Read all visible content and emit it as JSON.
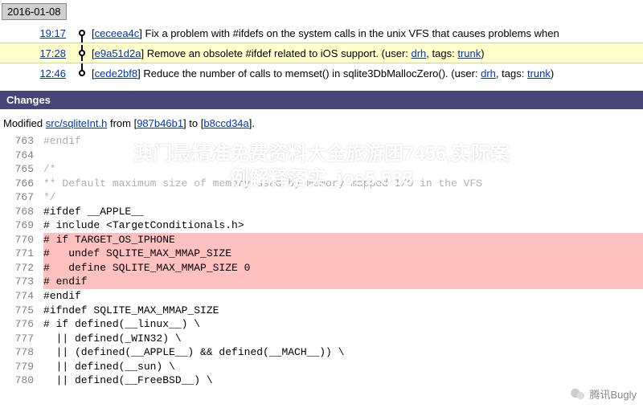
{
  "date_badge": "2016-01-08",
  "commits": [
    {
      "time": "19:17",
      "hash": "ceceea4c",
      "msg": "Fix a problem with #ifdefs on the system calls in the unix VFS that causes problems when"
    },
    {
      "time": "17:28",
      "hash": "e9a51d2a",
      "msg": "Remove an obsolete #ifdef related to iOS support. (user: ",
      "user": "drh",
      "tags_prefix": ", tags: ",
      "tags": "trunk",
      "suffix": ")"
    },
    {
      "time": "12:46",
      "hash": "cede2bf8",
      "msg": "Reduce the number of calls to memset() in sqlite3DbMallocZero(). (user: ",
      "user": "drh",
      "tags_prefix": ", tags: ",
      "tags": "trunk",
      "suffix": ")"
    }
  ],
  "section_header": "Changes",
  "modified": {
    "prefix": "Modified ",
    "file": "src/sqliteInt.h",
    "from_text": " from ",
    "from_hash": "987b46b1",
    "to_text": " to ",
    "to_hash": "b8ccd34a",
    "suffix": "."
  },
  "code": [
    {
      "ln": "763",
      "cls": "faint",
      "txt": "#endif"
    },
    {
      "ln": "764",
      "cls": "faint",
      "txt": ""
    },
    {
      "ln": "765",
      "cls": "faint",
      "txt": "/*"
    },
    {
      "ln": "766",
      "cls": "faint",
      "txt": "** Default maximum size of memory used by memory-mapped I/O in the VFS"
    },
    {
      "ln": "767",
      "cls": "faint",
      "txt": "*/"
    },
    {
      "ln": "768",
      "cls": "",
      "txt": "#ifdef __APPLE__"
    },
    {
      "ln": "769",
      "cls": "",
      "txt": "# include <TargetConditionals.h>"
    },
    {
      "ln": "770",
      "cls": "removed",
      "txt": "# if TARGET_OS_IPHONE"
    },
    {
      "ln": "771",
      "cls": "removed",
      "txt": "#   undef SQLITE_MAX_MMAP_SIZE"
    },
    {
      "ln": "772",
      "cls": "removed",
      "txt": "#   define SQLITE_MAX_MMAP_SIZE 0"
    },
    {
      "ln": "773",
      "cls": "removed",
      "txt": "# endif"
    },
    {
      "ln": "774",
      "cls": "",
      "txt": "#endif"
    },
    {
      "ln": "775",
      "cls": "",
      "txt": "#ifndef SQLITE_MAX_MMAP_SIZE"
    },
    {
      "ln": "776",
      "cls": "",
      "txt": "# if defined(__linux__) \\"
    },
    {
      "ln": "777",
      "cls": "",
      "txt": "  || defined(_WIN32) \\"
    },
    {
      "ln": "778",
      "cls": "",
      "txt": "  || (defined(__APPLE__) && defined(__MACH__)) \\"
    },
    {
      "ln": "779",
      "cls": "",
      "txt": "  || defined(__sun) \\"
    },
    {
      "ln": "780",
      "cls": "",
      "txt": "  || defined(__FreeBSD__) \\"
    }
  ],
  "overlay": {
    "line1": "澳门最精准免费资料大全旅游团7456,实际案",
    "line2": "例解释落实_ios5.533"
  },
  "footer_brand": "腾讯Bugly"
}
